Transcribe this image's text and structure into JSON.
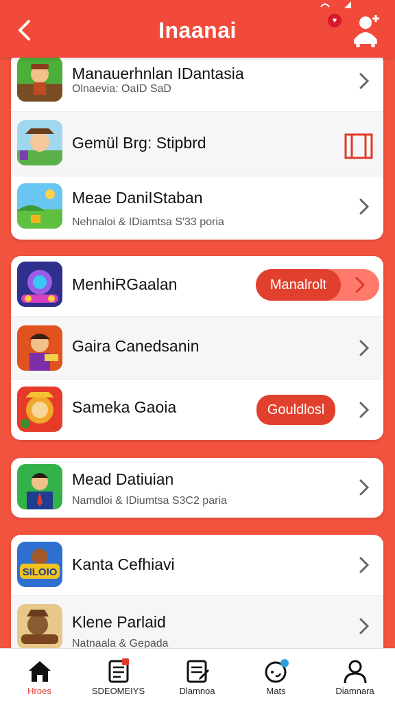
{
  "header": {
    "title": "Inaanai",
    "notification_badge": "♥"
  },
  "colors": {
    "brand": "#f14a3b",
    "accent_button": "#e2402e",
    "background": "#f1533f",
    "card": "#ffffff"
  },
  "lists": [
    {
      "rows": [
        {
          "title": "Manauerhnlan IDantasia",
          "subtitle": "Olnaevia: OaID SaD",
          "icon": "adventure-game-icon",
          "action": "chevron"
        },
        {
          "title": "Gemül Brg: Stipbrd",
          "subtitle": "",
          "icon": "cowboy-game-icon",
          "action": "box-icon"
        },
        {
          "title": "Meae DaniIStaban",
          "subtitle": "Nehnaloi & IDiamtsa S'33 poria",
          "icon": "landscape-game-icon",
          "action": "chevron"
        }
      ]
    },
    {
      "rows": [
        {
          "title": "MenhiRGaalan",
          "subtitle": "",
          "icon": "robot-game-icon",
          "action": "open-combo",
          "button_label": "Manalrolt"
        },
        {
          "title": "Gaira Canedsanin",
          "subtitle": "",
          "icon": "hero-game-icon",
          "action": "chevron"
        },
        {
          "title": "Sameka Gaoia",
          "subtitle": "",
          "icon": "lion-game-icon",
          "action": "pill",
          "button_label": "Gouldlosl"
        }
      ]
    },
    {
      "rows": [
        {
          "title": "Mead Datiuian",
          "subtitle": "Namdloi & IDiumtsa S3C2 paria",
          "icon": "businessman-game-icon",
          "action": "chevron"
        }
      ]
    },
    {
      "rows": [
        {
          "title": "Kanta Cefhiavi",
          "subtitle": "",
          "icon": "silolo-game-icon",
          "icon_text": "SILOIO",
          "action": "chevron"
        },
        {
          "title": "Klene Parlaid",
          "subtitle": "Natnaala & Gepada",
          "icon": "bear-game-icon",
          "action": "chevron"
        }
      ]
    }
  ],
  "tabs": [
    {
      "label": "Hroes",
      "icon": "home-icon",
      "active": true
    },
    {
      "label": "SDEOMEIYS",
      "icon": "document-badge-icon",
      "active": false
    },
    {
      "label": "Dlamnoa",
      "icon": "notes-icon",
      "active": false
    },
    {
      "label": "Mats",
      "icon": "chat-icon",
      "active": false
    },
    {
      "label": "Diamnara",
      "icon": "profile-icon",
      "active": false
    }
  ]
}
